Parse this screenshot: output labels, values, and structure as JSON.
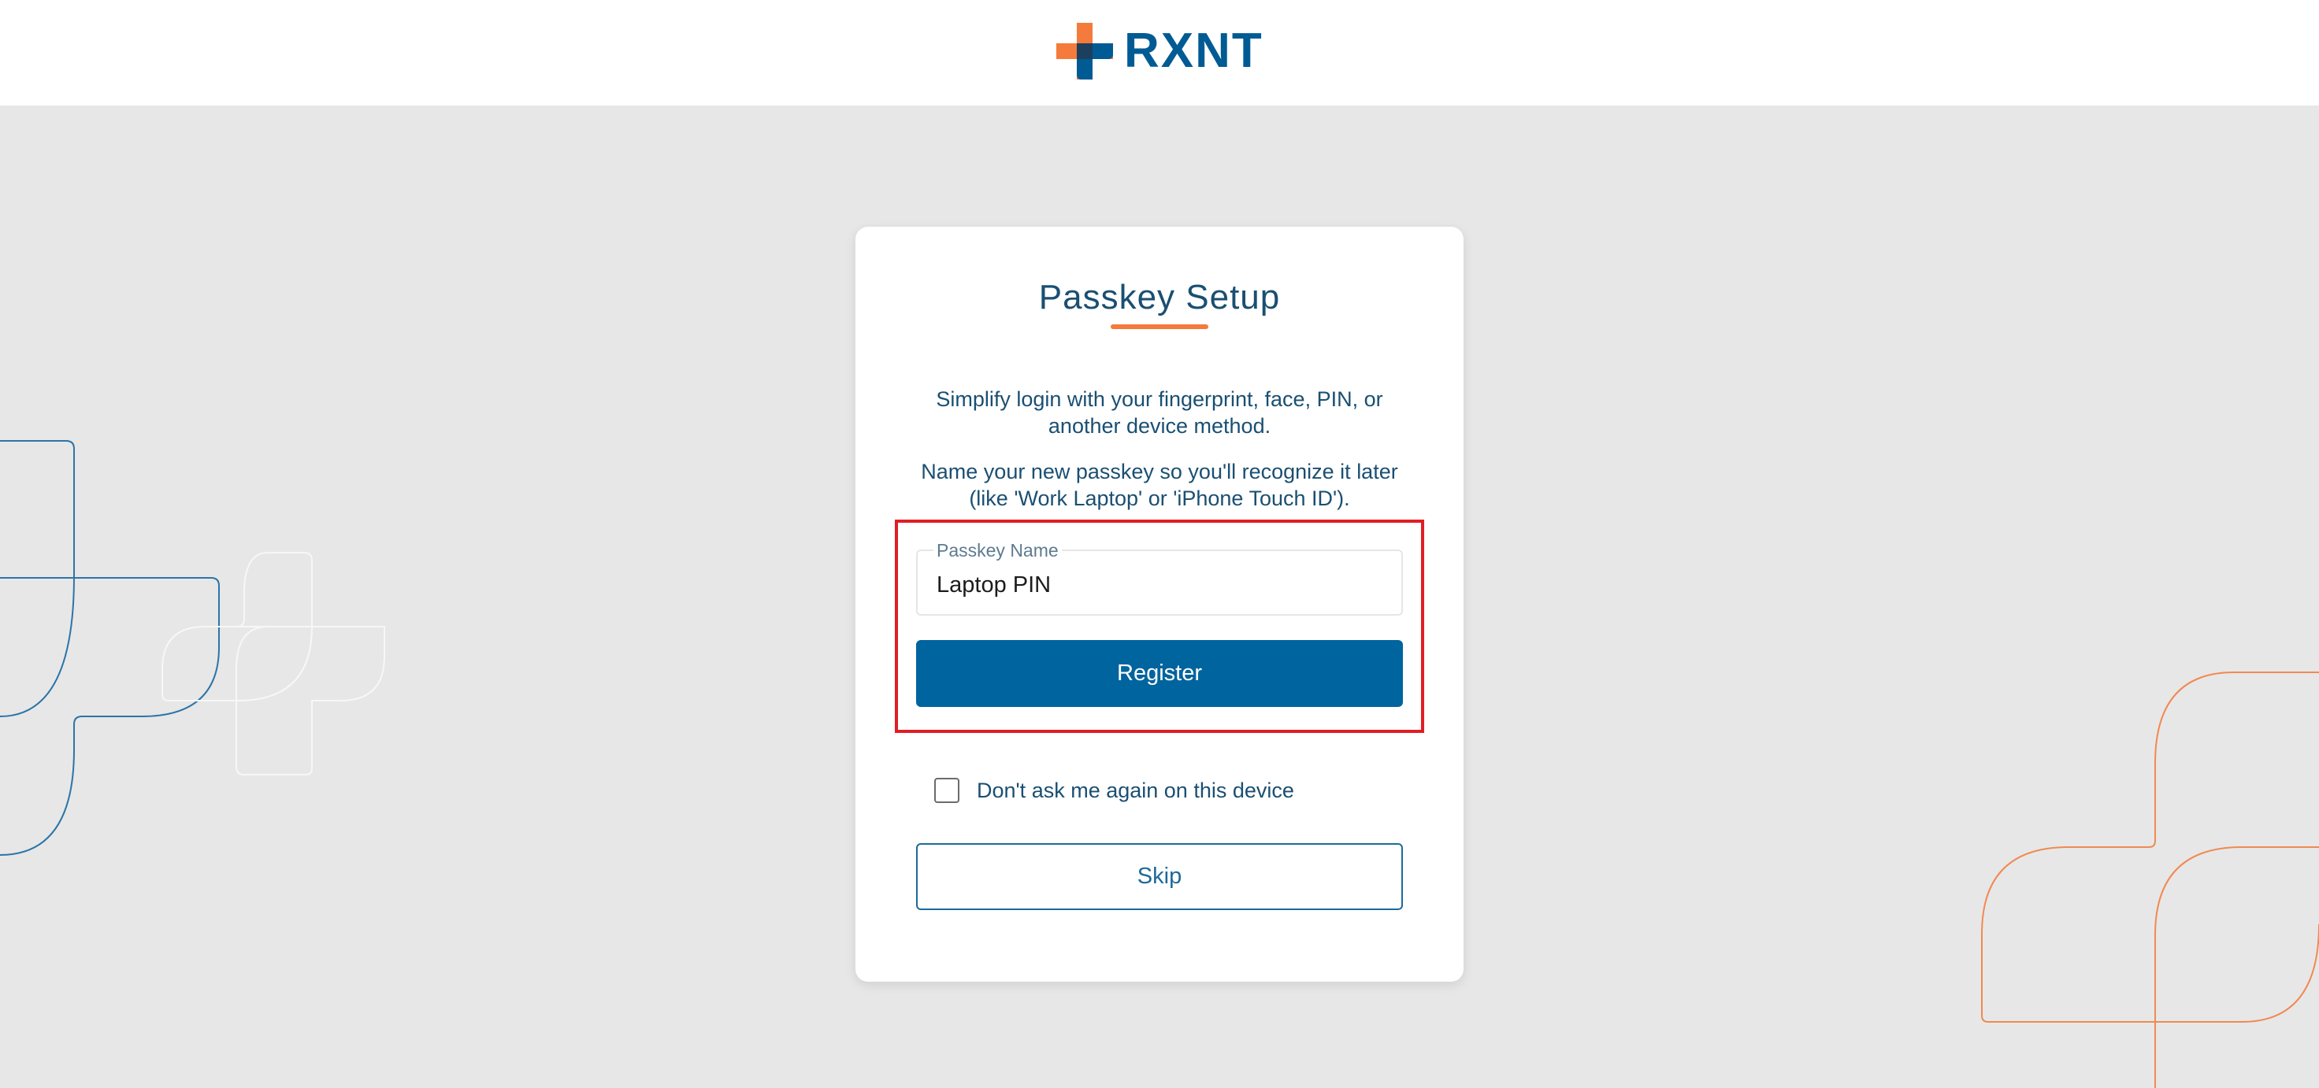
{
  "brand": {
    "name": "RXNT",
    "colors": {
      "primary": "#005b94",
      "accent": "#f47b3b",
      "button": "#00649e",
      "highlight": "#e11d24"
    }
  },
  "card": {
    "title": "Passkey Setup",
    "description_1": "Simplify login with your fingerprint, face, PIN, or another device method.",
    "description_2": "Name your new passkey so you'll recognize it later (like 'Work Laptop' or 'iPhone Touch ID').",
    "passkey_field": {
      "label": "Passkey Name",
      "value": "Laptop PIN"
    },
    "register_label": "Register",
    "dont_ask_label": "Don't ask me again on this device",
    "dont_ask_checked": false,
    "skip_label": "Skip"
  }
}
